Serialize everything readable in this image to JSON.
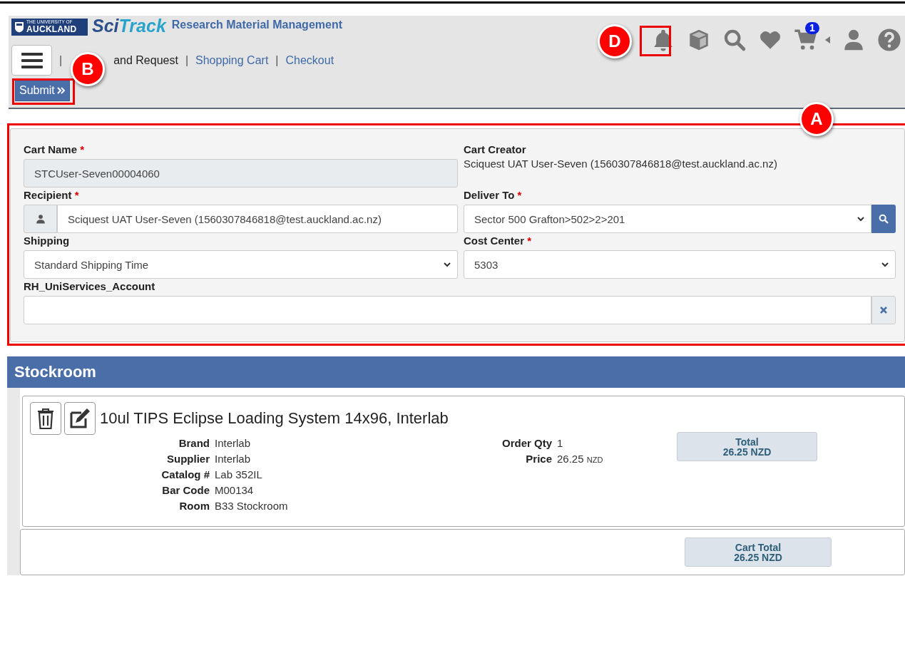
{
  "header": {
    "logo_lines": [
      "THE UNIVERSITY OF",
      "AUCKLAND"
    ],
    "app_name": [
      "Sci",
      "Track"
    ],
    "app_subtitle": "Research Material Management",
    "cart_count": "1",
    "nav": [
      {
        "label": "and Request",
        "selected": true,
        "separator": "|"
      },
      {
        "label": "Shopping Cart",
        "selected": false,
        "separator": "|"
      },
      {
        "label": "Checkout",
        "selected": false,
        "separator": "|"
      }
    ],
    "submit": {
      "label": "Submit"
    }
  },
  "form": {
    "fields": [
      {
        "kind": "readonly",
        "label": "Cart Name",
        "required_mark": "*",
        "value": "STCUser-Seven00004060"
      },
      {
        "kind": "text",
        "label": "Cart Creator",
        "value": "Sciquest UAT User-Seven (1560307846818@test.auckland.ac.nz)"
      },
      {
        "kind": "person-input",
        "label": "Recipient",
        "required_mark": "*",
        "value": "Sciquest UAT User-Seven (1560307846818@test.auckland.ac.nz)"
      },
      {
        "kind": "select-search",
        "label": "Deliver To",
        "required_mark": "*",
        "value": "Sector 500 Grafton>502>2>201"
      },
      {
        "kind": "select",
        "label": "Shipping",
        "value": "Standard Shipping Time"
      },
      {
        "kind": "select",
        "label": "Cost Center",
        "required_mark": "*",
        "value": "5303"
      },
      {
        "kind": "clearable-input",
        "label": "RH_UniServices_Account"
      }
    ]
  },
  "section": {
    "title": "Stockroom"
  },
  "items": [
    {
      "title": "10ul TIPS Eclipse Loading System 14x96, Interlab",
      "details": [
        {
          "label": "Brand",
          "value": "Interlab"
        },
        {
          "label": "Supplier",
          "value": "Interlab"
        },
        {
          "label": "Catalog #",
          "value": "Lab 352IL"
        },
        {
          "label": "Bar Code",
          "value": "M00134"
        },
        {
          "label": "Room",
          "value": "B33 Stockroom"
        }
      ],
      "order": [
        {
          "label": "Order Qty",
          "value": "1"
        },
        {
          "label": "Price",
          "value": "26.25",
          "unit": "NZD"
        }
      ],
      "total": {
        "label": "Total",
        "value": "26.25 NZD"
      }
    }
  ],
  "cart_total": {
    "label": "Cart Total",
    "value": "26.25 NZD"
  },
  "callouts": [
    {
      "label": "D",
      "kind": "bell"
    },
    {
      "label": "B",
      "kind": "submit"
    },
    {
      "label": "A",
      "kind": "form"
    }
  ]
}
